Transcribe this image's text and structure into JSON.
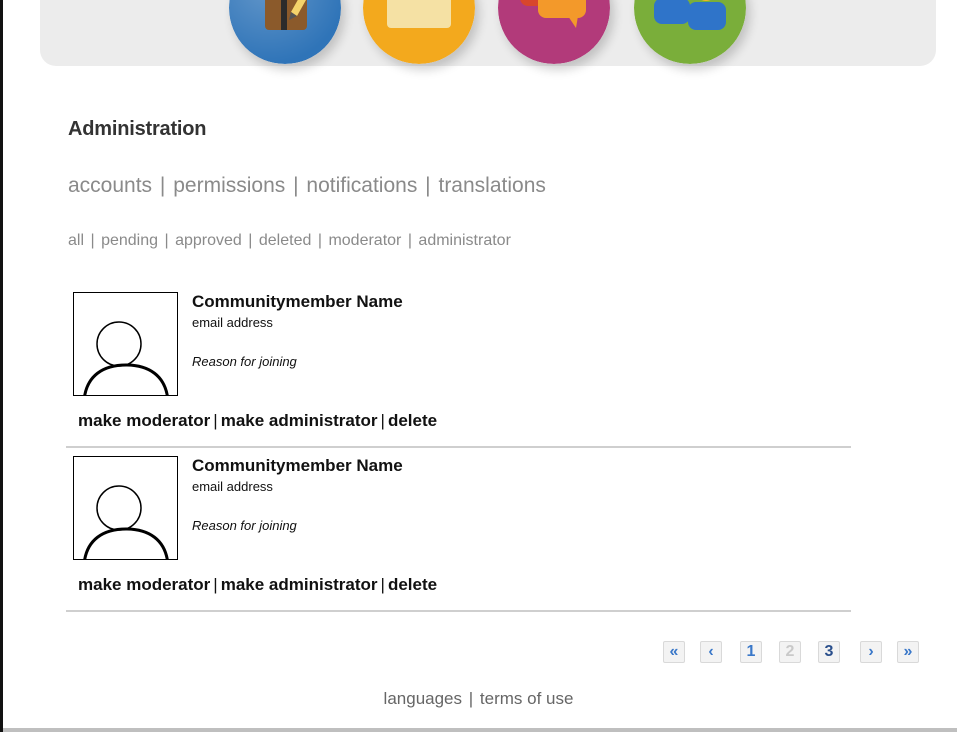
{
  "header": {
    "nav_icons": [
      {
        "name": "journal-icon",
        "color": "#2f74b8"
      },
      {
        "name": "folder-icon",
        "color": "#f3a91d"
      },
      {
        "name": "chat-bubbles-icon",
        "color": "#b23a7a"
      },
      {
        "name": "people-icon",
        "color": "#7aae3a"
      }
    ]
  },
  "page": {
    "title": "Administration"
  },
  "main_nav": {
    "items": [
      "accounts",
      "permissions",
      "notifications",
      "translations"
    ]
  },
  "sub_nav": {
    "items": [
      "all",
      "pending",
      "approved",
      "deleted",
      "moderator",
      "administrator"
    ]
  },
  "members": [
    {
      "name": "Communitymember Name",
      "email": "email address",
      "reason": "Reason for joining",
      "actions": [
        "make moderator",
        "make administrator",
        "delete"
      ]
    },
    {
      "name": "Communitymember Name",
      "email": "email address",
      "reason": "Reason for joining",
      "actions": [
        "make moderator",
        "make administrator",
        "delete"
      ]
    }
  ],
  "pagination": {
    "first": "«",
    "prev": "‹",
    "pages": [
      "1",
      "2",
      "3"
    ],
    "disabled_page": "2",
    "next": "›",
    "last": "»"
  },
  "footer": {
    "links": [
      "languages",
      "terms of use"
    ]
  }
}
